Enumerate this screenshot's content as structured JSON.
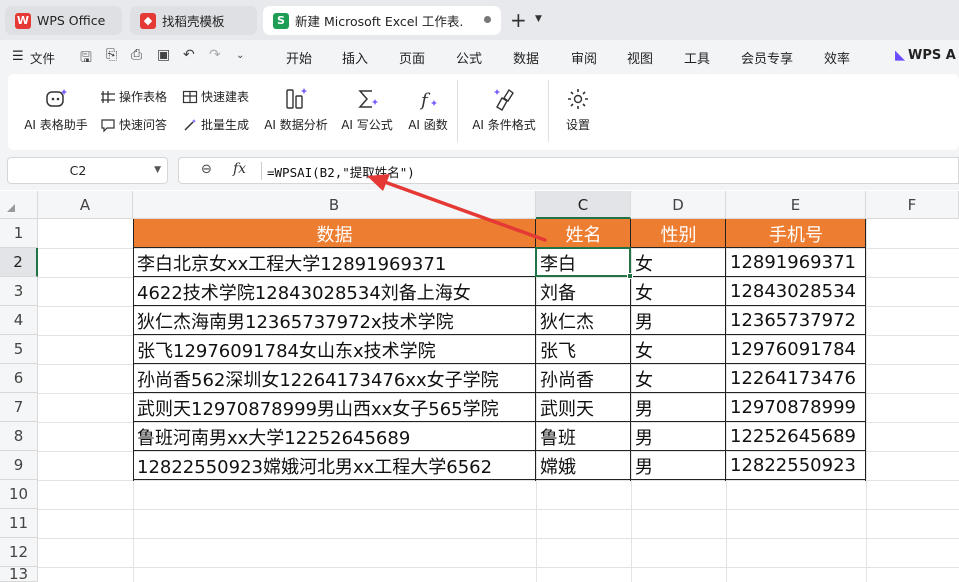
{
  "tabs": [
    {
      "label": "WPS Office",
      "icon": "wps-logo-icon"
    },
    {
      "label": "找稻壳模板",
      "icon": "docer-icon"
    },
    {
      "label": "新建 Microsoft Excel 工作表.",
      "icon": "spreadsheet-icon"
    }
  ],
  "menubar": {
    "file_label": "文件",
    "items": [
      "开始",
      "插入",
      "页面",
      "公式",
      "数据",
      "审阅",
      "视图",
      "工具",
      "会员专享",
      "效率"
    ],
    "wps_ai_label": "WPS A"
  },
  "ribbon": {
    "ai_table_assistant": "AI 表格助手",
    "operate_table": "操作表格",
    "quick_build_table": "快速建表",
    "quick_ask": "快速问答",
    "batch_generate": "批量生成",
    "ai_data_analysis": "AI 数据分析",
    "ai_write_formula": "AI 写公式",
    "ai_function": "AI 函数",
    "ai_conditional_format": "AI 条件格式",
    "settings": "设置"
  },
  "formula_bar": {
    "name_box": "C2",
    "fx_label": "fx",
    "formula": "=WPSAI(B2,\"提取姓名\")"
  },
  "columns": [
    "A",
    "B",
    "C",
    "D",
    "E",
    "F"
  ],
  "rows": [
    "1",
    "2",
    "3",
    "4",
    "5",
    "6",
    "7",
    "8",
    "9",
    "10",
    "11",
    "12",
    "13"
  ],
  "selected_cell": "C2",
  "table": {
    "headers": [
      "数据",
      "姓名",
      "性别",
      "手机号"
    ],
    "rows": [
      [
        "李白北京女xx工程大学12891969371",
        "李白",
        "女",
        "12891969371"
      ],
      [
        "4622技术学院12843028534刘备上海女",
        "刘备",
        "女",
        "12843028534"
      ],
      [
        "狄仁杰海南男12365737972x技术学院",
        "狄仁杰",
        "男",
        "12365737972"
      ],
      [
        "张飞12976091784女山东x技术学院",
        "张飞",
        "女",
        "12976091784"
      ],
      [
        "孙尚香562深圳女12264173476xx女子学院",
        "孙尚香",
        "女",
        "12264173476"
      ],
      [
        "武则天12970878999男山西xx女子565学院",
        "武则天",
        "男",
        "12970878999"
      ],
      [
        "鲁班河南男xx大学12252645689",
        "鲁班",
        "男",
        "12252645689"
      ],
      [
        "12822550923嫦娥河北男xx工程大学6562",
        "嫦娥",
        "男",
        "12822550923"
      ]
    ]
  },
  "colors": {
    "header_fill": "#ed7d31",
    "selection": "#217346",
    "annotation_arrow": "#e53935",
    "ai_accent": "#6b4dff"
  }
}
